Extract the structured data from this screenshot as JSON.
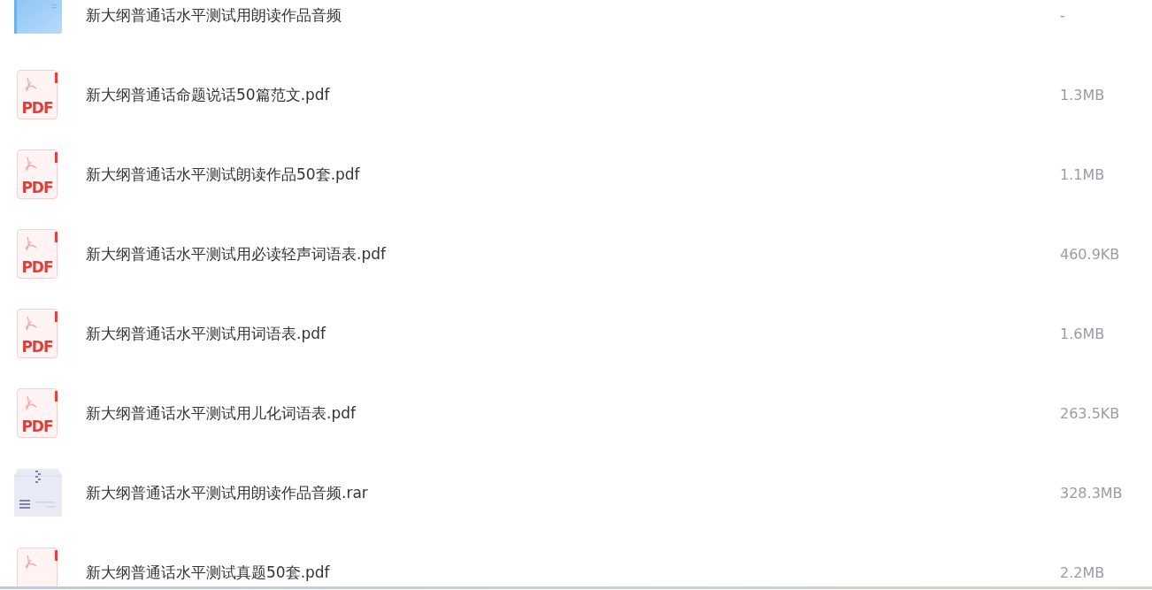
{
  "files": [
    {
      "kind": "folder",
      "name": "新大纲普通话水平测试用朗读作品音频",
      "size": "-"
    },
    {
      "kind": "pdf",
      "icon_label": "PDF",
      "name": "新大纲普通话命题说话50篇范文.pdf",
      "size": "1.3MB"
    },
    {
      "kind": "pdf",
      "icon_label": "PDF",
      "name": "新大纲普通话水平测试朗读作品50套.pdf",
      "size": "1.1MB"
    },
    {
      "kind": "pdf",
      "icon_label": "PDF",
      "name": "新大纲普通话水平测试用必读轻声词语表.pdf",
      "size": "460.9KB"
    },
    {
      "kind": "pdf",
      "icon_label": "PDF",
      "name": "新大纲普通话水平测试用词语表.pdf",
      "size": "1.6MB"
    },
    {
      "kind": "pdf",
      "icon_label": "PDF",
      "name": "新大纲普通话水平测试用儿化词语表.pdf",
      "size": "263.5KB"
    },
    {
      "kind": "archive",
      "name": "新大纲普通话水平测试用朗读作品音频.rar",
      "size": "328.3MB"
    },
    {
      "kind": "pdf",
      "name": "新大纲普通话水平测试真题50套.pdf",
      "size": "2.2MB"
    }
  ]
}
